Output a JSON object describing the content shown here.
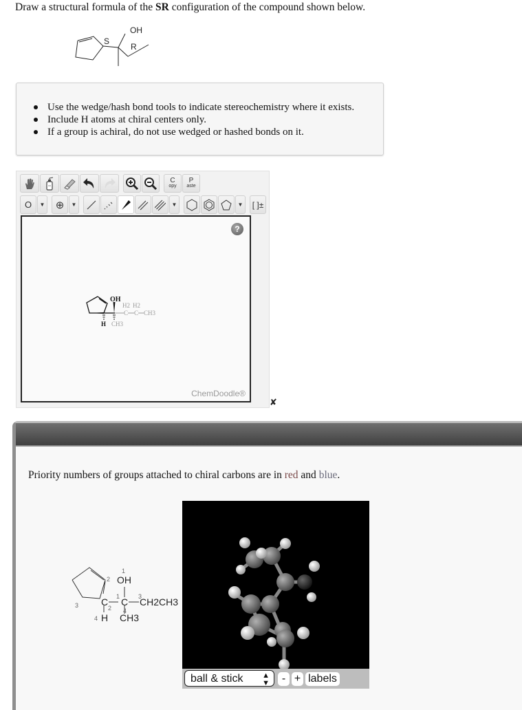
{
  "question": {
    "prefix": "Draw a structural formula of the ",
    "bold": "SR",
    "suffix": " configuration of the compound shown below."
  },
  "given_structure": {
    "labels": {
      "oh": "OH",
      "stereo_ring": "S",
      "stereo_carbinol": "R"
    }
  },
  "instructions": [
    "Use the wedge/hash bond tools to indicate stereochemistry where it exists.",
    "Include H atoms at chiral centers only.",
    "If a group is achiral, do not use wedged or hashed bonds on it."
  ],
  "sketcher": {
    "toolbar_row1": [
      {
        "name": "pan-icon",
        "title": "Pan"
      },
      {
        "name": "clear-icon",
        "title": "Clear"
      },
      {
        "name": "eraser-icon",
        "title": "Erase"
      },
      {
        "name": "undo-icon",
        "title": "Undo"
      },
      {
        "name": "redo-icon",
        "title": "Redo"
      },
      {
        "name": "zoom-in-icon",
        "title": "Zoom In"
      },
      {
        "name": "zoom-out-icon",
        "title": "Zoom Out"
      }
    ],
    "copy_label": {
      "big": "C",
      "small": "opy"
    },
    "paste_label": {
      "big": "P",
      "small": "aste"
    },
    "atom_label": "O",
    "charge_label": "⊕",
    "bracket_label": "[ ]±",
    "selected_tool": "wedge-bond",
    "help_label": "?",
    "brand": "ChemDoodle®",
    "drawn_structure": {
      "oh": "OH",
      "h": "H",
      "ch2_a": "H2",
      "ch2_b": "H2",
      "c_a": "C",
      "c_b": "C",
      "ch3_end": "CH3",
      "ch3_down": "CH3"
    }
  },
  "close_label": "✘",
  "solution": {
    "priority_note": {
      "prefix": "Priority numbers of groups attached to chiral carbons are in ",
      "red": "red",
      "middle": " and ",
      "blue": "blue",
      "suffix": "."
    },
    "annotated": {
      "oh": "OH",
      "c_ring": "C",
      "c_center": "C",
      "ch2ch3": "CH2CH3",
      "h": "H",
      "ch3": "CH3",
      "priorities": {
        "oh": "1",
        "center_c": "1",
        "ethyl": "3",
        "methyl": "4",
        "ring_left": "2",
        "alkene": "2",
        "ring_ch2": "3",
        "h": "4"
      }
    },
    "viewer": {
      "render_mode": "ball & stick",
      "minus_label": "-",
      "plus_label": "+",
      "labels_label": "labels"
    }
  }
}
